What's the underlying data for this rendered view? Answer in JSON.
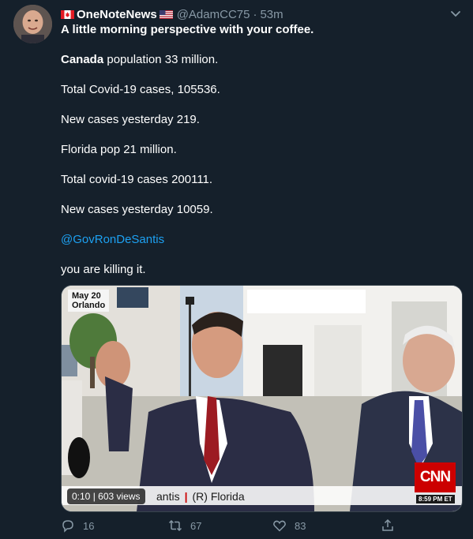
{
  "tweet": {
    "display_name": "OneNoteNews",
    "handle": "@AdamCC75",
    "separator": "·",
    "time": "53m",
    "lines": {
      "l1": "A little morning perspective with your coffee.",
      "l2_bold": "Canada",
      "l2_rest": " population 33 million.",
      "l3": "Total Covid-19 cases, 105536.",
      "l4": "New cases yesterday 219.",
      "l5": "Florida pop 21 million.",
      "l6": "Total covid-19 cases 200111.",
      "l7": "New cases yesterday 10059.",
      "l8": "@GovRonDeSantis",
      "l9": "you are killing it."
    },
    "media": {
      "date_line1": "May 20",
      "date_line2": "Orlando",
      "chyron_name": "antis",
      "chyron_sep": "|",
      "chyron_party": "(R) Florida",
      "network": "CNN",
      "network_time": "8:59 PM ET",
      "video_time": "0:10",
      "video_views": "603 views"
    },
    "actions": {
      "replies": "16",
      "retweets": "67",
      "likes": "83"
    }
  },
  "icons": {
    "avatar": "avatar",
    "flags": [
      "canada-flag-icon",
      "us-flag-icon"
    ],
    "menu": "chevron-down-icon",
    "reply": "reply-icon",
    "retweet": "retweet-icon",
    "like": "heart-icon",
    "share": "share-icon"
  },
  "colors": {
    "background": "#15202b",
    "secondary_text": "#8899a6",
    "link": "#1da1f2",
    "cnn_red": "#cc0000"
  }
}
